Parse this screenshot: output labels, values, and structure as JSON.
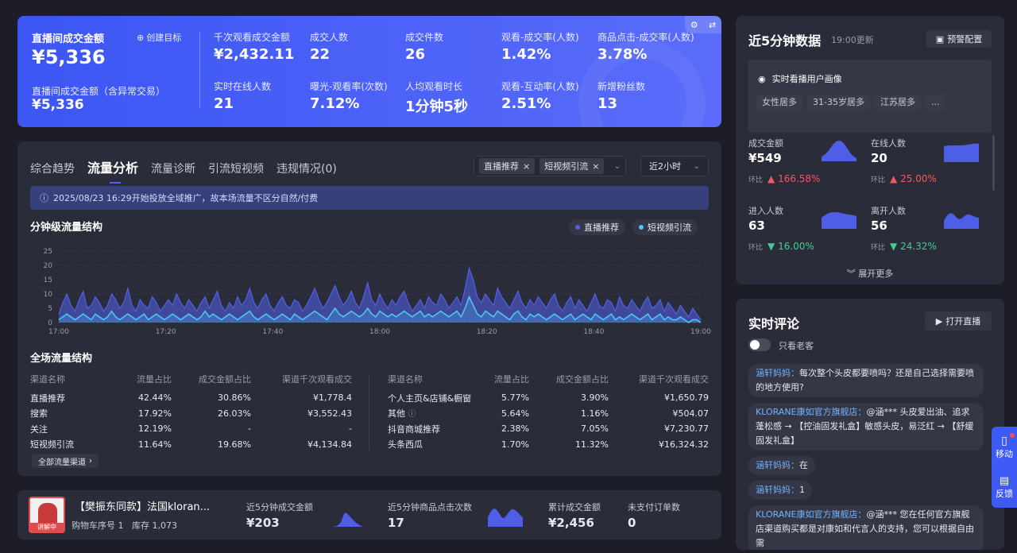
{
  "stats": {
    "gmv_label": "直播间成交金额",
    "create_goal": "创建目标",
    "gmv_value": "¥5,336",
    "gmv_abn_label": "直播间成交金额（含异常交易）",
    "gmv_abn_value": "¥5,336",
    "items": [
      {
        "label": "千次观看成交金额",
        "value": "¥2,432.11"
      },
      {
        "label": "成交人数",
        "value": "22"
      },
      {
        "label": "成交件数",
        "value": "26"
      },
      {
        "label": "观看-成交率(人数)",
        "value": "1.42%"
      },
      {
        "label": "商品点击-成交率(人数)",
        "value": "3.78%"
      },
      {
        "label": "实时在线人数",
        "value": "21"
      },
      {
        "label": "曝光-观看率(次数)",
        "value": "7.12%"
      },
      {
        "label": "人均观看时长",
        "value": "1分钟5秒"
      },
      {
        "label": "观看-互动率(人数)",
        "value": "2.51%"
      },
      {
        "label": "新增粉丝数",
        "value": "13"
      }
    ]
  },
  "main": {
    "tabs": [
      "综合趋势",
      "流量分析",
      "流量诊断",
      "引流短视频",
      "违规情况(0)"
    ],
    "filter_chips": [
      "直播推荐",
      "短视频引流"
    ],
    "time_select": "近2小时",
    "notice": "2025/08/23 16:29开始投放全域推广，故本场流量不区分自然/付费",
    "chart_title": "分钟级流量结构",
    "legend": [
      "直播推荐",
      "短视频引流"
    ],
    "table_title": "全场流量结构",
    "table_headers": [
      "渠道名称",
      "流量占比",
      "成交金额占比",
      "渠道千次观看成交"
    ],
    "left_rows": [
      [
        "直播推荐",
        "42.44%",
        "30.86%",
        "¥1,778.4"
      ],
      [
        "搜索",
        "17.92%",
        "26.03%",
        "¥3,552.43"
      ],
      [
        "关注",
        "12.19%",
        "-",
        "-"
      ],
      [
        "短视频引流",
        "11.64%",
        "19.68%",
        "¥4,134.84"
      ]
    ],
    "right_rows": [
      [
        "个人主页&店铺&橱窗",
        "5.77%",
        "3.90%",
        "¥1,650.79"
      ],
      [
        "其他",
        "5.64%",
        "1.16%",
        "¥504.07"
      ],
      [
        "抖音商城推荐",
        "2.38%",
        "7.05%",
        "¥7,230.77"
      ],
      [
        "头条西瓜",
        "1.70%",
        "11.32%",
        "¥16,324.32"
      ]
    ],
    "all_channels": "全部流量渠道"
  },
  "chart_data": {
    "type": "area",
    "x_ticks": [
      "17:00",
      "17:20",
      "17:40",
      "18:00",
      "18:20",
      "18:40",
      "19:00"
    ],
    "y_ticks": [
      0,
      5,
      10,
      15,
      20,
      25
    ],
    "ylim": [
      0,
      25
    ],
    "series": [
      {
        "name": "直播推荐",
        "color": "#5060e8",
        "values": [
          3,
          7,
          10,
          6,
          4,
          8,
          11,
          5,
          6,
          9,
          7,
          4,
          6,
          10,
          8,
          5,
          7,
          12,
          6,
          4,
          8,
          6,
          5,
          9,
          7,
          4,
          6,
          8,
          6,
          10,
          7,
          5,
          8,
          6,
          4,
          7,
          9,
          5,
          8,
          11,
          6,
          4,
          7,
          5,
          9,
          6,
          8,
          12,
          7,
          5,
          8,
          10,
          6,
          4,
          7,
          9,
          6,
          5,
          8,
          7,
          4,
          6,
          9,
          12,
          8,
          5,
          7,
          10,
          13,
          9,
          6,
          8,
          11,
          7,
          5,
          9,
          14,
          8,
          6,
          10,
          7,
          5,
          8,
          6,
          9,
          11,
          7,
          4,
          6,
          8,
          5,
          9,
          7,
          6,
          10,
          8,
          5,
          7,
          9,
          6,
          12,
          19,
          15,
          9,
          7,
          10,
          8,
          6,
          12,
          9,
          7,
          5,
          8,
          11,
          7,
          5,
          8,
          6,
          9,
          7,
          5,
          8,
          10,
          6,
          4,
          7,
          9,
          5,
          8,
          6,
          4,
          7,
          10,
          6,
          5,
          8,
          7,
          4,
          9,
          6,
          5,
          8,
          6,
          4,
          7,
          9,
          5,
          6,
          8,
          4,
          7,
          5,
          3,
          6,
          4,
          2,
          5,
          3,
          1
        ]
      },
      {
        "name": "短视频引流",
        "color": "#4fc3f7",
        "values": [
          1,
          2,
          3,
          2,
          1,
          2,
          3,
          2,
          1,
          3,
          2,
          1,
          2,
          4,
          2,
          1,
          2,
          3,
          2,
          1,
          2,
          3,
          1,
          2,
          3,
          2,
          1,
          2,
          3,
          2,
          1,
          2,
          3,
          2,
          1,
          2,
          4,
          2,
          3,
          2,
          1,
          2,
          3,
          2,
          1,
          2,
          3,
          4,
          2,
          1,
          2,
          3,
          2,
          1,
          2,
          3,
          2,
          1,
          3,
          2,
          1,
          2,
          3,
          4,
          3,
          2,
          1,
          3,
          5,
          3,
          2,
          3,
          4,
          3,
          2,
          3,
          5,
          3,
          2,
          4,
          3,
          2,
          3,
          2,
          3,
          4,
          3,
          2,
          3,
          4,
          2,
          3,
          2,
          3,
          4,
          3,
          2,
          3,
          4,
          2,
          5,
          9,
          6,
          3,
          2,
          4,
          3,
          2,
          4,
          3,
          2,
          1,
          3,
          4,
          2,
          1,
          3,
          2,
          3,
          2,
          1,
          2,
          3,
          2,
          1,
          2,
          3,
          1,
          2,
          3,
          2,
          1,
          3,
          2,
          1,
          2,
          3,
          1,
          2,
          1,
          2,
          3,
          2,
          1,
          2,
          3,
          1,
          2,
          3,
          1,
          2,
          1,
          1,
          2,
          1,
          0,
          1,
          1,
          0
        ]
      }
    ]
  },
  "product": {
    "badge": "讲解中",
    "title": "【樊振东同款】法国kloran...",
    "cart_no": "购物车序号 1",
    "stock": "库存 1,073",
    "m1_label": "近5分钟成交金额",
    "m1_value": "¥203",
    "m2_label": "近5分钟商品点击次数",
    "m2_value": "17",
    "m3_label": "累计成交金额",
    "m3_value": "¥2,456",
    "m4_label": "未支付订单数",
    "m4_value": "0"
  },
  "recent": {
    "title": "近5分钟数据",
    "updated": "19:00更新",
    "alert_btn": "预警配置",
    "portrait_title": "实时看播用户画像",
    "tags": [
      "女性居多",
      "31-35岁居多",
      "江苏居多",
      "..."
    ],
    "compare": "环比",
    "metrics": [
      {
        "label": "成交金额",
        "value": "¥549",
        "change": "166.58%",
        "dir": "up"
      },
      {
        "label": "在线人数",
        "value": "20",
        "change": "25.00%",
        "dir": "up"
      },
      {
        "label": "进入人数",
        "value": "63",
        "change": "16.00%",
        "dir": "down"
      },
      {
        "label": "离开人数",
        "value": "56",
        "change": "24.32%",
        "dir": "down"
      }
    ],
    "expand": "展开更多"
  },
  "comments": {
    "title": "实时评论",
    "open_live": "打开直播",
    "only_old": "只看老客",
    "list": [
      {
        "user": "涵轩妈妈：",
        "text": "每次整个头皮都要喷吗？还是自己选择需要喷的地方使用?"
      },
      {
        "user": "KLORANE康如官方旗舰店：",
        "text": "@涵*** 头皮爱出油、追求蓬松感 → 【控油固发礼盒】敏感头皮，易泛红 → 【舒缓固发礼盒】"
      },
      {
        "user": "涵轩妈妈：",
        "text": "在"
      },
      {
        "user": "涵轩妈妈：",
        "text": "1"
      },
      {
        "user": "KLORANE康如官方旗舰店：",
        "text": "@涵*** 您在任何官方旗舰店渠道购买都是对康如和代言人的支持，您可以根据自由需"
      }
    ]
  },
  "side": {
    "move": "移动",
    "feedback": "反馈"
  }
}
